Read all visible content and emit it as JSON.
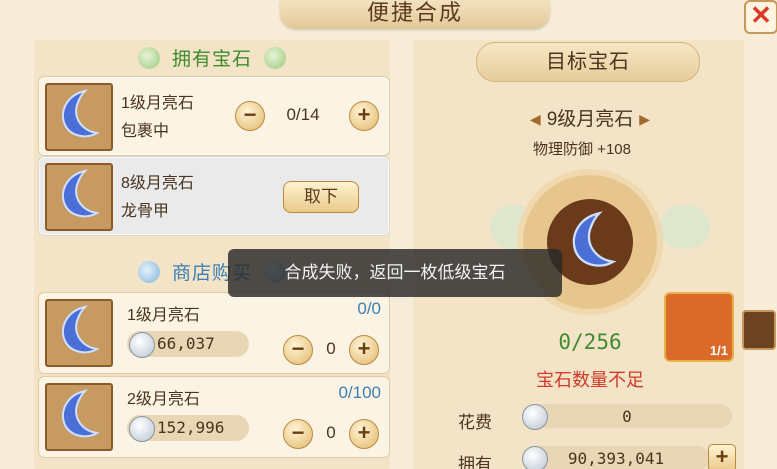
{
  "window": {
    "title": "便捷合成",
    "close_icon": "close-icon"
  },
  "owned_section": {
    "title": "拥有宝石",
    "items": [
      {
        "name": "1级月亮石",
        "location": "包裹中",
        "count": "0/14",
        "minus": "−",
        "plus": "+"
      },
      {
        "name": "8级月亮石",
        "location": "龙骨甲",
        "action": "取下"
      }
    ]
  },
  "shop_section": {
    "title": "商店购买",
    "items": [
      {
        "name": "1级月亮石",
        "stock": "0/0",
        "price": "66,037",
        "qty": "0",
        "minus": "−",
        "plus": "+"
      },
      {
        "name": "2级月亮石",
        "stock": "0/100",
        "price": "152,996",
        "qty": "0",
        "minus": "−",
        "plus": "+"
      }
    ]
  },
  "toast": "合成失败，返回一枚低级宝石",
  "target": {
    "title": "目标宝石",
    "level_name": "9级月亮石",
    "attribute": "物理防御 +108",
    "progress": "0/256",
    "warning": "宝石数量不足",
    "chest_qty": "1/1"
  },
  "cost": {
    "label": "花费",
    "value": "0"
  },
  "own": {
    "label": "拥有",
    "value": "90,393,041",
    "plus": "+"
  },
  "colors": {
    "green": "#3f8b2e",
    "blue": "#3c7fb6",
    "red": "#d23a2a"
  }
}
